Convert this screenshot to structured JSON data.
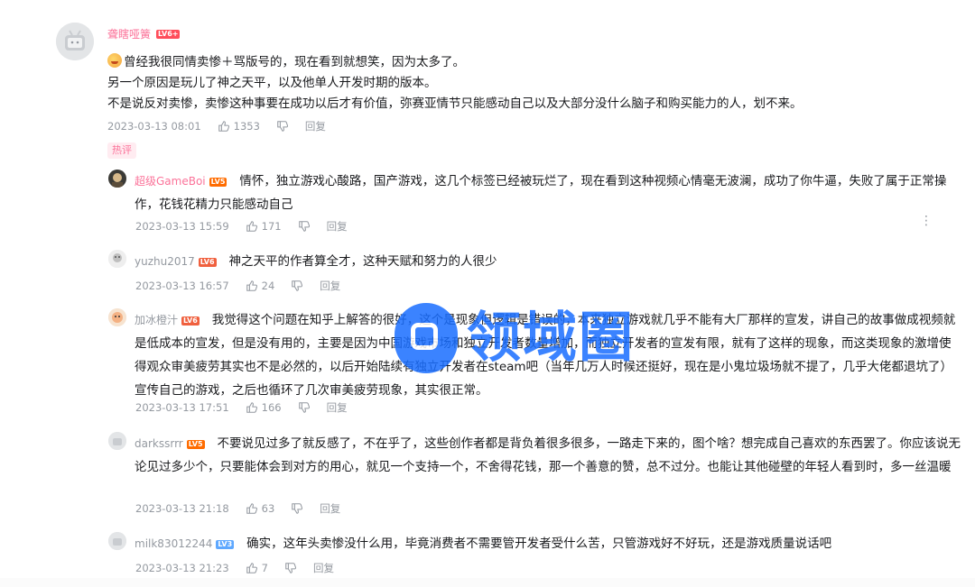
{
  "main_comment": {
    "username": "聋瞎哑簧",
    "level": "LV6+",
    "lines": [
      "曾经我很同情卖惨＋骂版号的，现在看到就想笑，因为太多了。",
      "另一个原因是玩儿了神之天平，以及他单人开发时期的版本。",
      "不是说反对卖惨，卖惨这种事要在成功以后才有价值，弥赛亚情节只能感动自己以及大部分没什么脑子和购买能力的人，划不来。"
    ],
    "date": "2023-03-13 08:01",
    "likes": "1353",
    "reply_label": "回复",
    "hot_tag": "热评"
  },
  "replies": [
    {
      "username": "超级GameBoi",
      "level": "LV5",
      "text": "情怀，独立游戏心酸路，国产游戏，这几个标签已经被玩烂了，现在看到这种视频心情毫无波澜，成功了你牛逼，失败了属于正常操作，花钱花精力只能感动自己",
      "date": "2023-03-13 15:59",
      "likes": "171",
      "reply_label": "回复"
    },
    {
      "username": "yuzhu2017",
      "level": "LV6",
      "text": "神之天平的作者算全才，这种天赋和努力的人很少",
      "date": "2023-03-13 16:57",
      "likes": "24",
      "reply_label": "回复"
    },
    {
      "username": "加冰橙汁",
      "level": "LV6",
      "text": "我觉得这个问题在知乎上解答的很好，这个是现象但逻辑是错误的，本来独立游戏就几乎不能有大厂那样的宣发，讲自己的故事做成视频就是低成本的宣发，但是没有用的，主要是因为中国游戏市场和独立开发者数量增加，而独立开发者的宣发有限，就有了这样的现象，而这类现象的激增使得观众审美疲劳其实也不是必然的，以后开始陆续有独立开发者在steam吧（当年几万人时候还挺好，现在是小鬼垃圾场就不提了，几乎大佬都退坑了）宣传自己的游戏，之后也循环了几次审美疲劳现象，其实很正常。",
      "date": "2023-03-13 17:51",
      "likes": "166",
      "reply_label": "回复"
    },
    {
      "username": "darkssrrr",
      "level": "LV5",
      "text": "不要说见过多了就反感了，不在乎了，这些创作者都是背负着很多很多，一路走下来的，图个啥？想完成自己喜欢的东西罢了。你应该说无论见过多少个，只要能体会到对方的用心，就见一个支持一个，不舍得花钱，那一个善意的赞，总不过分。也能让其他碰壁的年轻人看到时，多一丝温暖",
      "date": "2023-03-13 21:18",
      "likes": "63",
      "reply_label": "回复"
    },
    {
      "username": "milk83012244",
      "level": "LV3",
      "text": "确实，这年头卖惨没什么用，毕竟消费者不需要管开发者受什么苦，只管游戏好不好玩，还是游戏质量说话吧",
      "date": "2023-03-13 21:23",
      "likes": "7",
      "reply_label": "回复"
    }
  ],
  "watermark": "领域圈",
  "colors": {
    "accent": "#fb7299",
    "meta": "#9499a0",
    "watermark": "#1a6eff"
  }
}
